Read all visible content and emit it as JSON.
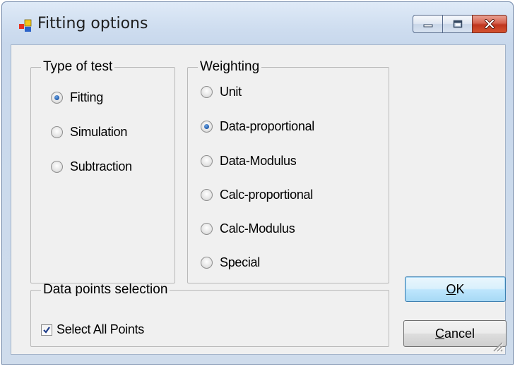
{
  "window": {
    "title": "Fitting options"
  },
  "type_of_test": {
    "legend": "Type of test",
    "options": [
      {
        "label": "Fitting",
        "checked": true
      },
      {
        "label": "Simulation",
        "checked": false
      },
      {
        "label": "Subtraction",
        "checked": false
      }
    ]
  },
  "weighting": {
    "legend": "Weighting",
    "options": [
      {
        "label": "Unit",
        "checked": false
      },
      {
        "label": "Data-proportional",
        "checked": true
      },
      {
        "label": "Data-Modulus",
        "checked": false
      },
      {
        "label": "Calc-proportional",
        "checked": false
      },
      {
        "label": "Calc-Modulus",
        "checked": false
      },
      {
        "label": "Special",
        "checked": false
      }
    ]
  },
  "data_points": {
    "legend": "Data points selection",
    "select_all_label": "Select All Points",
    "select_all_checked": true
  },
  "buttons": {
    "ok_mnemonic": "O",
    "ok_rest": "K",
    "cancel_mnemonic": "C",
    "cancel_rest": "ancel"
  },
  "colors": {
    "radio_dot": "#1d57a8",
    "default_button": "#3c7fb1",
    "close_button": "#c0361f"
  }
}
